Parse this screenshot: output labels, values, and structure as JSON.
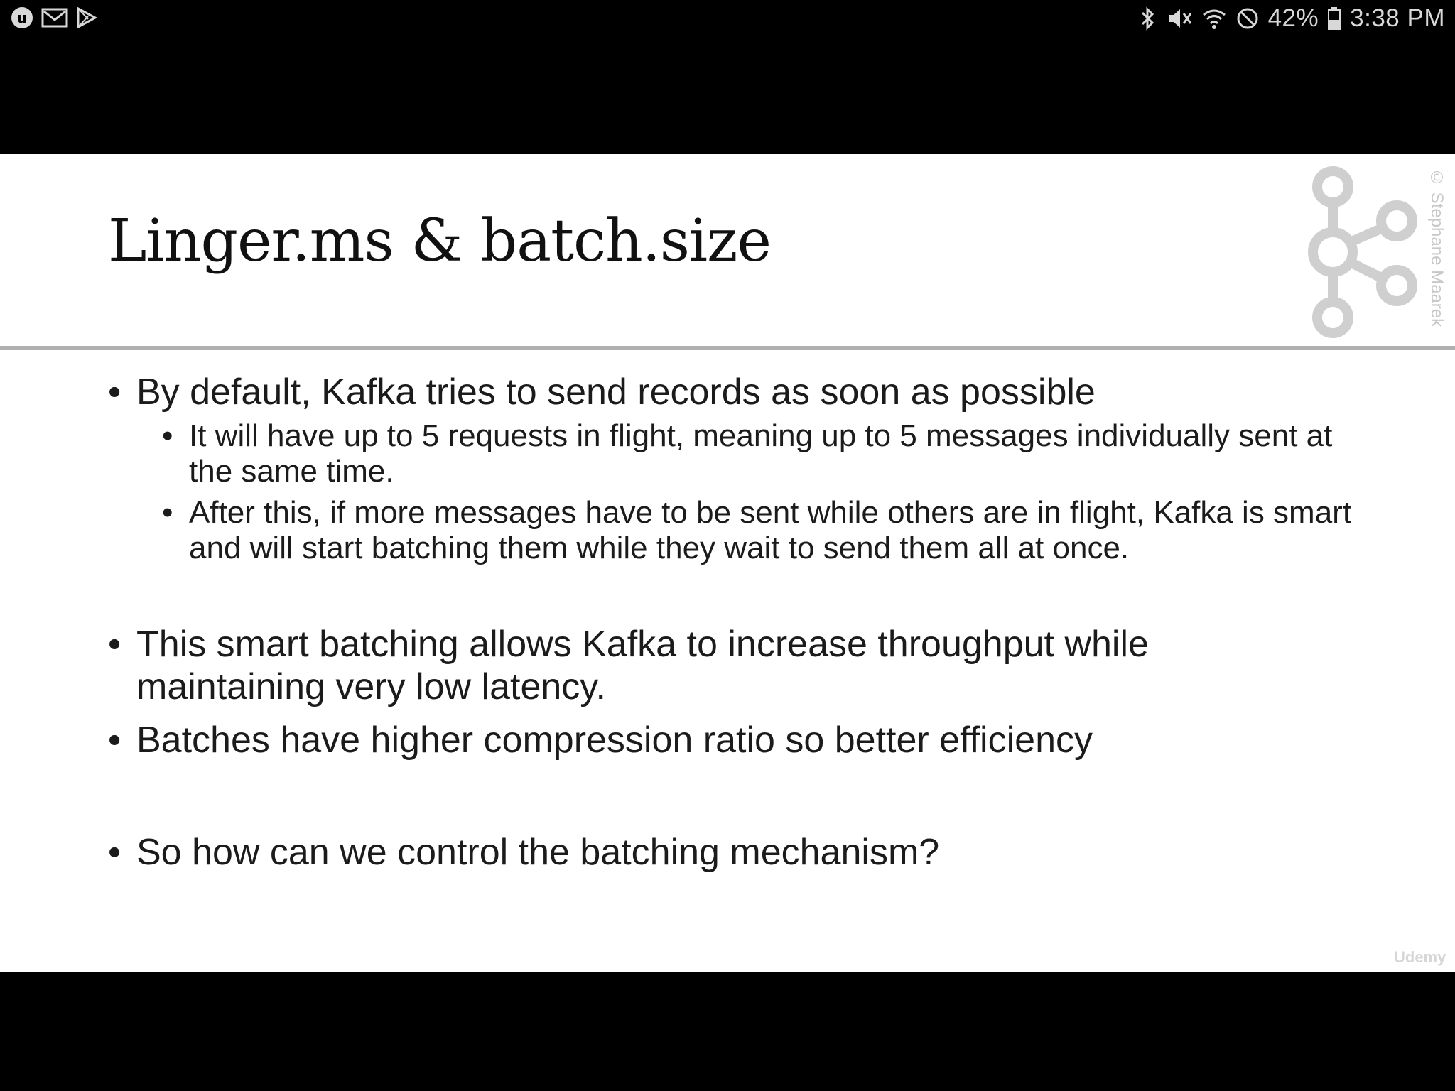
{
  "status_bar": {
    "left_icons": [
      "udemy-icon",
      "mail-icon",
      "play-store-icon"
    ],
    "right_icons": [
      "bluetooth-icon",
      "mute-icon",
      "wifi-icon",
      "do-not-disturb-icon",
      "battery-icon"
    ],
    "battery": "42%",
    "time": "3:38 PM"
  },
  "slide": {
    "title": "Linger.ms & batch.size",
    "credit": "© Stephane Maarek",
    "watermark": "Udemy",
    "bullets": [
      "By default, Kafka tries to send records as soon as possible",
      "It will have up to 5 requests in flight, meaning up to 5 messages individually sent at the same time.",
      "After this, if more messages have to be sent while others are in flight, Kafka is smart and will start batching them while they wait to send them all at once.",
      "This smart batching allows Kafka to increase throughput while maintaining very low latency.",
      "Batches have higher compression ratio so better efficiency",
      "So how can we control the batching mechanism?"
    ]
  }
}
